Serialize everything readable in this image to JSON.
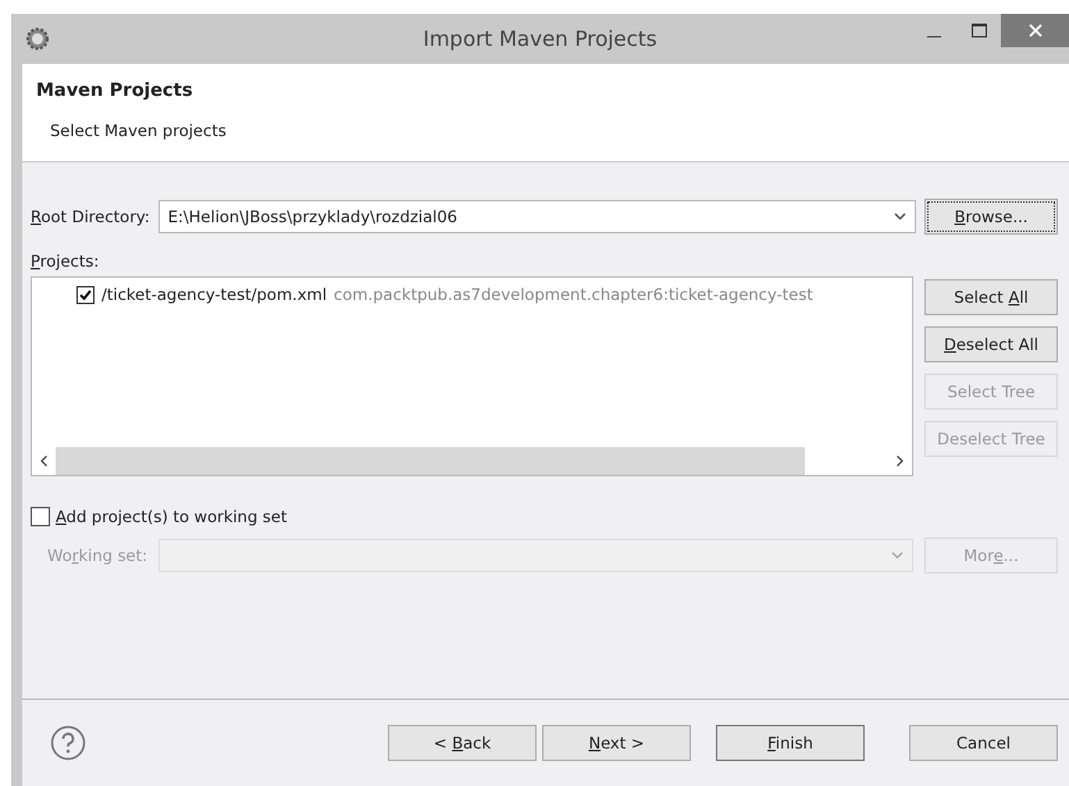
{
  "window": {
    "title": "Import Maven Projects"
  },
  "header": {
    "title": "Maven Projects",
    "subtitle": "Select Maven projects"
  },
  "root_directory": {
    "label": {
      "key": "R",
      "after": "oot Directory:"
    },
    "value": "E:\\Helion\\JBoss\\przyklady\\rozdzial06",
    "browse": {
      "key": "B",
      "after": "rowse..."
    }
  },
  "projects": {
    "label": {
      "key": "P",
      "after": "rojects:"
    },
    "items": [
      {
        "path": "/ticket-agency-test/pom.xml",
        "artifact": "com.packtpub.as7development.chapter6:ticket-agency-test",
        "checked": true
      }
    ],
    "buttons": [
      {
        "label": {
          "before": "Select ",
          "key": "A",
          "after": "ll"
        },
        "disabled": false
      },
      {
        "label": {
          "key": "D",
          "after": "eselect All"
        },
        "disabled": false
      },
      {
        "label": {
          "before": "Select Tree"
        },
        "disabled": true
      },
      {
        "label": {
          "before": "Deselect Tree"
        },
        "disabled": true
      }
    ]
  },
  "working_set": {
    "checkbox": {
      "label": {
        "key": "A",
        "after": "dd project(s) to working set"
      },
      "checked": false
    },
    "label": {
      "before": "Wo",
      "key": "r",
      "after": "king set:"
    },
    "disabled": true,
    "more": {
      "before": "Mor",
      "key": "e",
      "after": "..."
    }
  },
  "footer": {
    "buttons": [
      {
        "label": {
          "before": "< ",
          "key": "B",
          "after": "ack"
        },
        "kind": "normal"
      },
      {
        "label": {
          "key": "N",
          "after": "ext >"
        },
        "kind": "normal"
      },
      {
        "label": {
          "key": "F",
          "after": "inish"
        },
        "kind": "default"
      },
      {
        "label": {
          "before": "Cancel"
        },
        "kind": "normal"
      }
    ]
  }
}
